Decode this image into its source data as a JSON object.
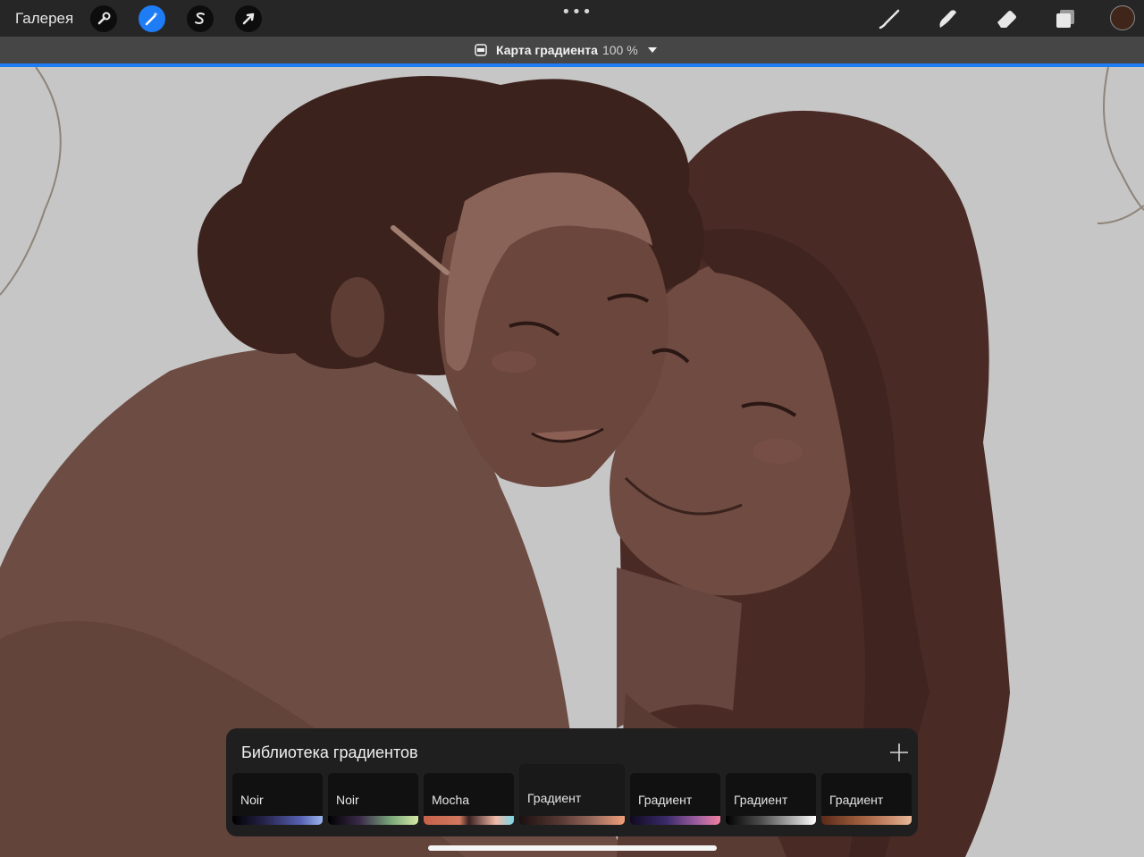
{
  "toolbar": {
    "gallery_label": "Галерея",
    "more_icon": "•••",
    "color": "#40261a"
  },
  "adjustment": {
    "name": "Карта градиента",
    "percent": "100 %"
  },
  "library": {
    "title": "Библиотека градиентов",
    "items": [
      {
        "label": "Noir"
      },
      {
        "label": "Noir"
      },
      {
        "label": "Mocha"
      },
      {
        "label": "Градиент"
      },
      {
        "label": "Градиент"
      },
      {
        "label": "Градиент"
      },
      {
        "label": "Градиент"
      }
    ]
  }
}
